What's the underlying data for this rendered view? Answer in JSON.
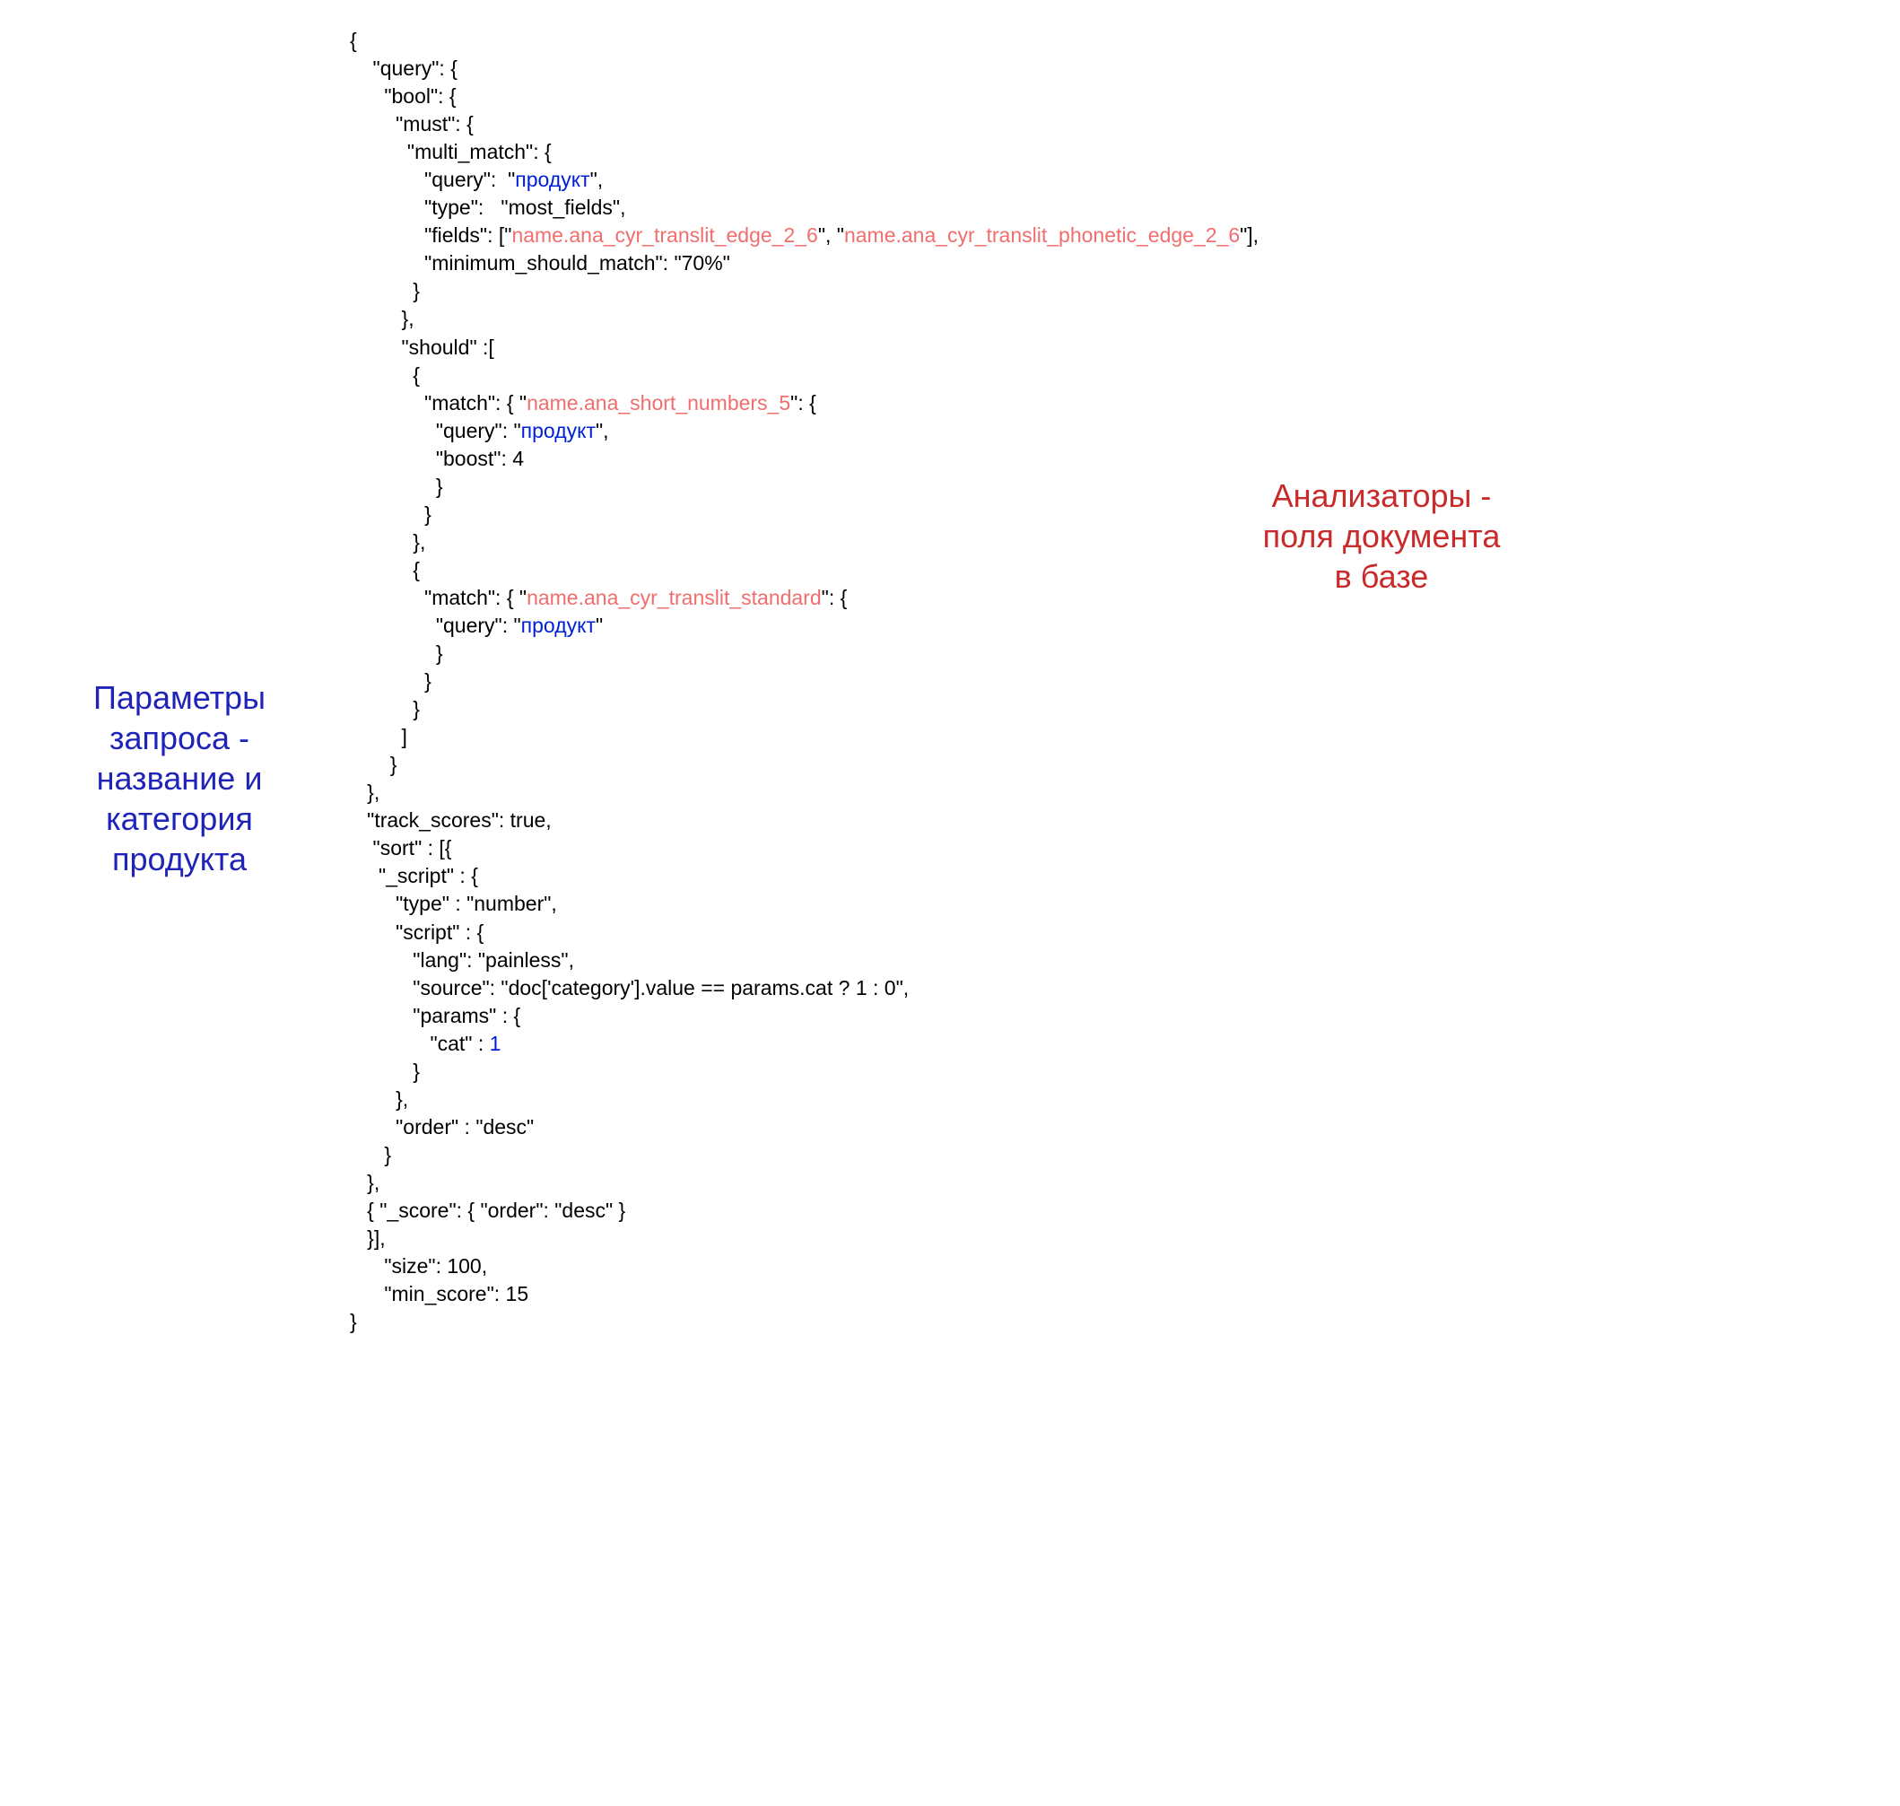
{
  "annotations": {
    "left": {
      "line1": "Параметры",
      "line2": "запроса -",
      "line3": "название и",
      "line4": "категория",
      "line5": "продукта"
    },
    "right": {
      "line1": "Анализаторы -",
      "line2": "поля документа",
      "line3": "в базе"
    }
  },
  "code": {
    "l01": "{",
    "l02": "    \"query\": {",
    "l03": "      \"bool\": {",
    "l04": "        \"must\": {",
    "l05": "          \"multi_match\": {",
    "l06a": "             \"query\":  \"",
    "l06b": "продукт",
    "l06c": "\",",
    "l07": "             \"type\":   \"most_fields\",",
    "l08a": "             \"fields\": [\"",
    "l08b": "name.ana_cyr_translit_edge_2_6",
    "l08c": "\", \"",
    "l08d": "name.ana_cyr_translit_phonetic_edge_2_6",
    "l08e": "\"],",
    "l09": "             \"minimum_should_match\": \"70%\"",
    "l10": "           }",
    "l11": "         },",
    "l12": "         \"should\" :[",
    "l13": "           {",
    "l14a": "             \"match\": { \"",
    "l14b": "name.ana_short_numbers_5",
    "l14c": "\": {",
    "l15a": "               \"query\": \"",
    "l15b": "продукт",
    "l15c": "\",",
    "l16": "               \"boost\": 4",
    "l17": "               }",
    "l18": "             }",
    "l19": "           },",
    "l20": "           {",
    "l21a": "             \"match\": { \"",
    "l21b": "name.ana_cyr_translit_standard",
    "l21c": "\": {",
    "l22a": "               \"query\": \"",
    "l22b": "продукт",
    "l22c": "\"",
    "l23": "               }",
    "l24": "             }",
    "l25": "           }",
    "l26": "         ]",
    "l27": "       }",
    "l28": "   },",
    "l29": "   \"track_scores\": true,",
    "l30": "    \"sort\" : [{",
    "l31": "     \"_script\" : {",
    "l32": "        \"type\" : \"number\",",
    "l33": "        \"script\" : {",
    "l34": "           \"lang\": \"painless\",",
    "l35": "           \"source\": \"doc['category'].value == params.cat ? 1 : 0\",",
    "l36": "           \"params\" : {",
    "l37a": "              \"cat\" : ",
    "l37b": "1",
    "l38": "           }",
    "l39": "        },",
    "l40": "        \"order\" : \"desc\"",
    "l41": "      }",
    "l42": "   },",
    "l43": "   { \"_score\": { \"order\": \"desc\" }",
    "l44": "   }],",
    "l45": "      \"size\": 100,",
    "l46": "      \"min_score\": 15",
    "l47": "}"
  }
}
